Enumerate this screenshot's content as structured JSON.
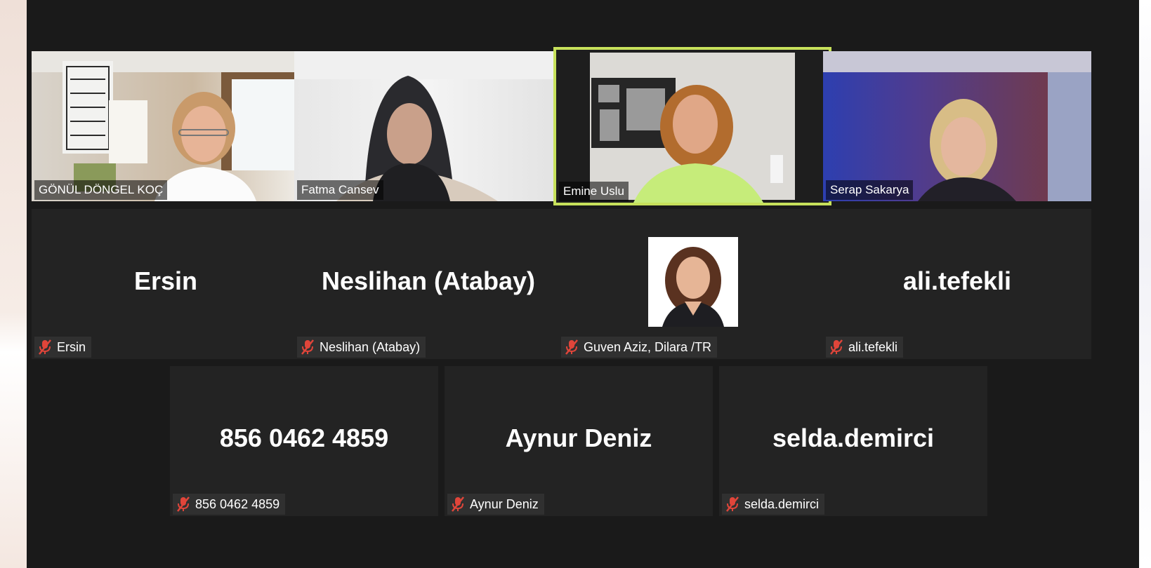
{
  "colors": {
    "active_speaker_border": "#c7e15b",
    "tile_background": "#232323",
    "meeting_background": "#1a1a1a",
    "mute_icon": "#e0453a"
  },
  "video_tiles": [
    {
      "name": "GÖNÜL DÖNGEL KOÇ"
    },
    {
      "name": "Fatma Cansev"
    },
    {
      "name": "Emine Uslu",
      "active_speaker": true
    },
    {
      "name": "Serap Sakarya"
    }
  ],
  "audio_tiles_row2": [
    {
      "display": "Ersin",
      "label": "Ersin",
      "muted_icon": "mic-muted-icon"
    },
    {
      "display": "Neslihan (Atabay)",
      "label": "Neslihan (Atabay)",
      "muted_icon": "mic-muted-icon"
    },
    {
      "display": "",
      "label": "Guven Aziz, Dilara /TR",
      "muted_icon": "mic-muted-icon",
      "has_profile_photo": true
    },
    {
      "display": "ali.tefekli",
      "label": "ali.tefekli",
      "muted_icon": "mic-muted-icon"
    }
  ],
  "audio_tiles_row3": [
    {
      "display": "856 0462 4859",
      "label": "856 0462 4859",
      "muted_icon": "mic-muted-icon"
    },
    {
      "display": "Aynur Deniz",
      "label": "Aynur Deniz",
      "muted_icon": "mic-muted-icon"
    },
    {
      "display": "selda.demirci",
      "label": "selda.demirci",
      "muted_icon": "mic-muted-icon"
    }
  ]
}
